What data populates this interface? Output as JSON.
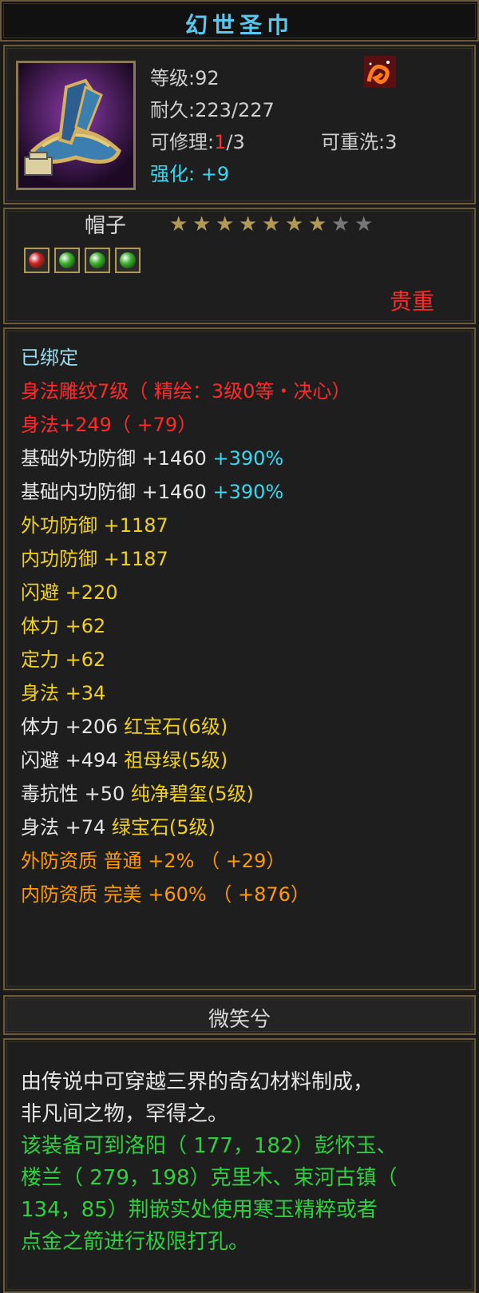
{
  "title": "幻世圣巾",
  "item": {
    "level": "等级:92",
    "durability": "耐久:223/227",
    "repair_label": "可修理:",
    "repair_current": "1",
    "repair_total": "/3",
    "rewash": "可重洗:3",
    "enhance": "强化: +9"
  },
  "type": {
    "slot": "帽子",
    "stars_total": 9,
    "stars_filled": 7,
    "rarity": "贵重",
    "gems": [
      "red-gem-icon",
      "green-gem-icon",
      "green-gem-icon",
      "green-gem-icon"
    ]
  },
  "attributes": [
    {
      "parts": [
        {
          "t": "已绑定",
          "c": "lightblue"
        }
      ]
    },
    {
      "parts": [
        {
          "t": "身法雕纹7级（ 精绘：3级0等・决心）",
          "c": "red"
        }
      ]
    },
    {
      "parts": [
        {
          "t": "身法+249（ +79）",
          "c": "red"
        }
      ]
    },
    {
      "parts": [
        {
          "t": "基础外功防御 +1460 ",
          "c": "white"
        },
        {
          "t": "+390%",
          "c": "cyan"
        }
      ]
    },
    {
      "parts": [
        {
          "t": "基础内功防御 +1460 ",
          "c": "white"
        },
        {
          "t": "+390%",
          "c": "cyan"
        }
      ]
    },
    {
      "parts": [
        {
          "t": "外功防御 +1187",
          "c": "yellow"
        }
      ]
    },
    {
      "parts": [
        {
          "t": "内功防御 +1187",
          "c": "yellow"
        }
      ]
    },
    {
      "parts": [
        {
          "t": "闪避 +220",
          "c": "yellow"
        }
      ]
    },
    {
      "parts": [
        {
          "t": "体力 +62",
          "c": "yellow"
        }
      ]
    },
    {
      "parts": [
        {
          "t": "定力 +62",
          "c": "yellow"
        }
      ]
    },
    {
      "parts": [
        {
          "t": "身法 +34",
          "c": "yellow"
        }
      ]
    },
    {
      "parts": [
        {
          "t": "体力 +206 ",
          "c": "white"
        },
        {
          "t": "红宝石(6级)",
          "c": "yellow"
        }
      ]
    },
    {
      "parts": [
        {
          "t": "闪避 +494 ",
          "c": "white"
        },
        {
          "t": "祖母绿(5级)",
          "c": "yellow"
        }
      ]
    },
    {
      "parts": [
        {
          "t": "毒抗性 +50 ",
          "c": "white"
        },
        {
          "t": "纯净碧玺(5级)",
          "c": "yellow"
        }
      ]
    },
    {
      "parts": [
        {
          "t": "身法 +74 ",
          "c": "white"
        },
        {
          "t": "绿宝石(5级)",
          "c": "yellow"
        }
      ]
    },
    {
      "parts": [
        {
          "t": "外防资质  普通 +2% （ +29）",
          "c": "orange"
        }
      ]
    },
    {
      "parts": [
        {
          "t": "内防资质  完美 +60% （ +876）",
          "c": "orange"
        }
      ]
    }
  ],
  "author": "微笑兮",
  "description": {
    "lines_white": [
      "由传说中可穿越三界的奇幻材料制成，",
      "非凡间之物，罕得之。"
    ],
    "lines_green": [
      "该装备可到洛阳（ 177，182）彭怀玉、",
      "楼兰（ 279，198）克里木、束河古镇（",
      "134，85）荆嵌实处使用寒玉精粹或者",
      "点金之箭进行极限打孔。"
    ]
  },
  "colors": {
    "accent": "#58c8f0",
    "frame": "#6b5a37",
    "star_filled": "#b29a55",
    "star_empty": "#777777"
  }
}
